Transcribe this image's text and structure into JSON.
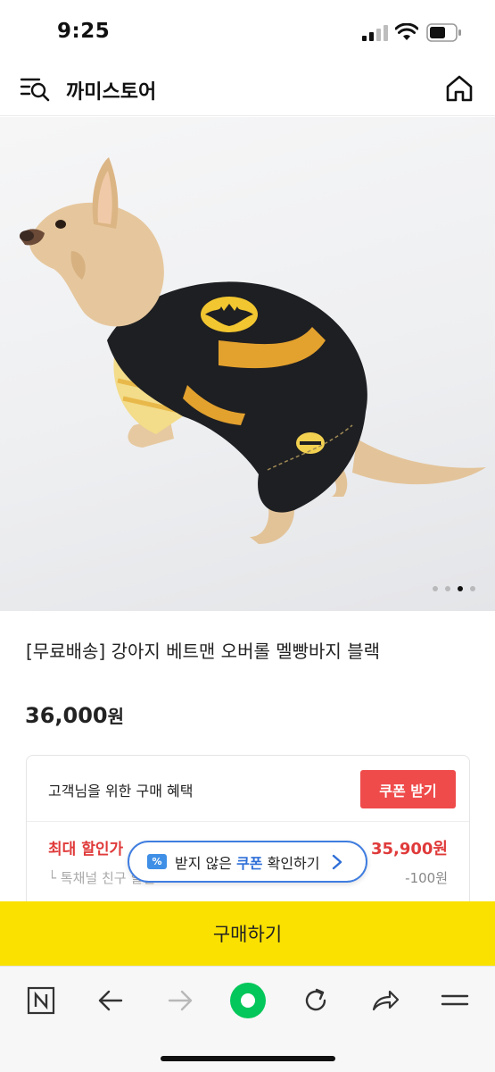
{
  "status_bar": {
    "time": "9:25"
  },
  "header": {
    "store_name": "까미스토어"
  },
  "product": {
    "title": "[무료배송] 강아지 베트맨 오버롤 멜빵바지 블랙",
    "price_number": "36,000",
    "price_unit": "원",
    "image_slider": {
      "total": 4,
      "active_index": 2
    }
  },
  "benefit": {
    "title": "고객님을 위한 구매 혜택",
    "coupon_button": "쿠폰 받기",
    "max_discount_label": "최대 할인가",
    "max_discount_price": "35,900원",
    "sub_label": "└ 톡채널 친구 할인",
    "sub_value": "-100원"
  },
  "coupon_pill": {
    "icon_text": "%",
    "text_before": "받지 않은 ",
    "text_highlight": "쿠폰",
    "text_after": " 확인하기"
  },
  "buy_button": {
    "label": "구매하기"
  },
  "toolbar": {
    "icons": [
      "naver-n-icon",
      "back-arrow-icon",
      "forward-arrow-icon",
      "green-dot-icon",
      "refresh-icon",
      "share-icon",
      "menu-icon"
    ]
  },
  "colors": {
    "buy_bar": "#fae100",
    "coupon_red": "#ef4b4b",
    "pill_blue": "#3f7de0",
    "green": "#03c75a"
  }
}
